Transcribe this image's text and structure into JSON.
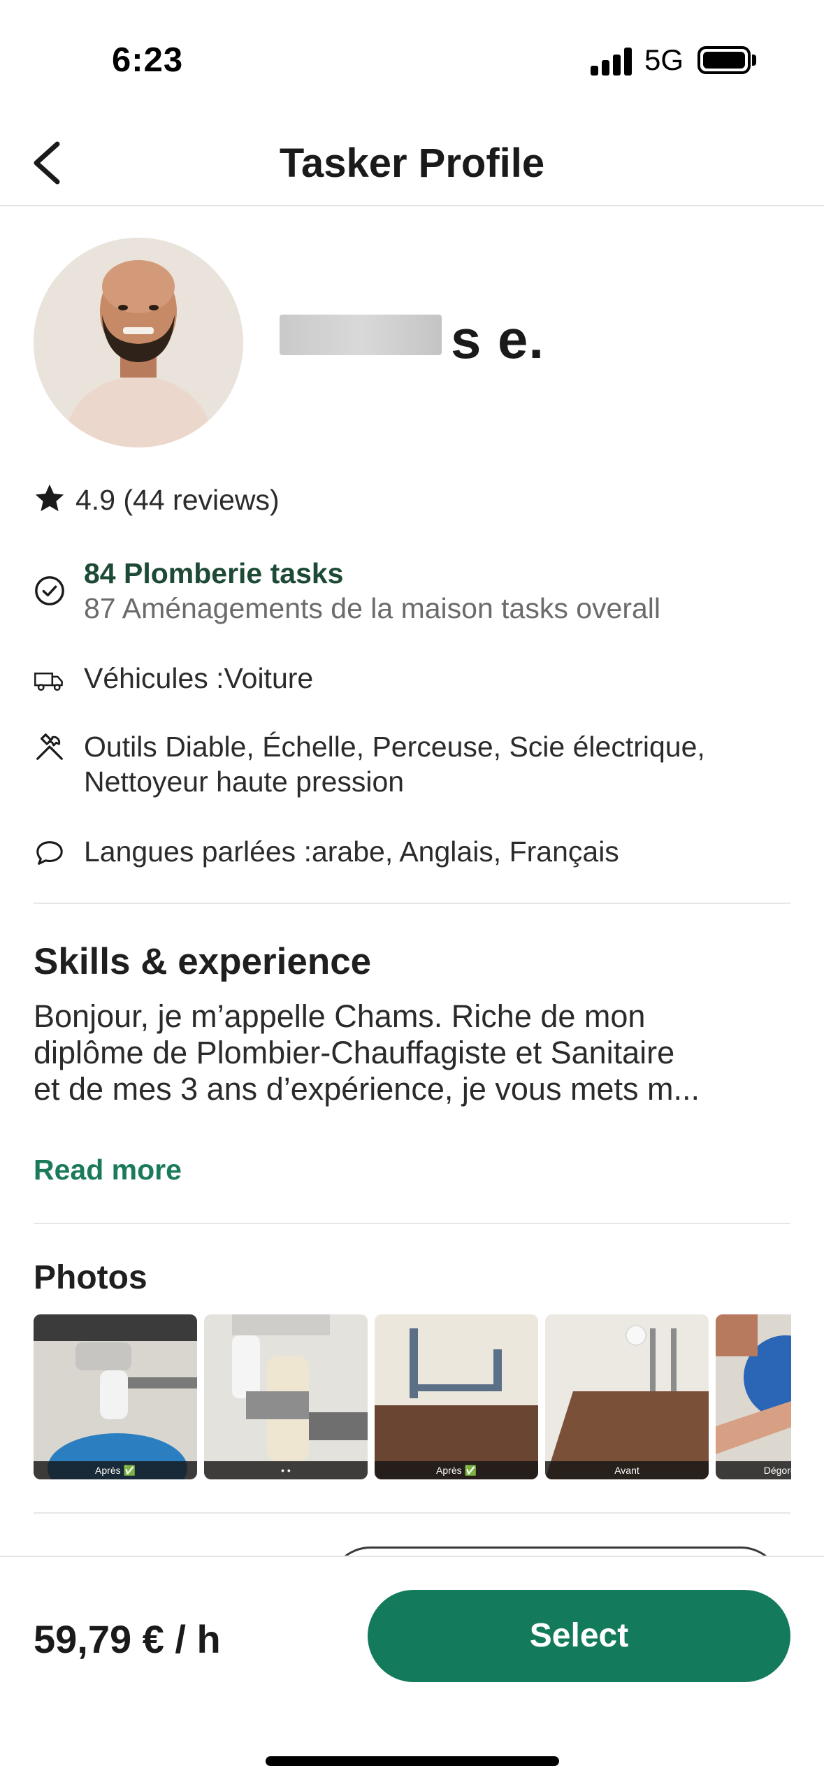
{
  "status_bar": {
    "time": "6:23",
    "network": "5G"
  },
  "header": {
    "title": "Tasker Profile"
  },
  "tasker": {
    "name_suffix": "s e."
  },
  "rating": {
    "text": "4.9 (44 reviews)"
  },
  "tasks": {
    "main": "84 Plomberie tasks",
    "overall": "87 Aménagements de la maison tasks overall"
  },
  "vehicles": {
    "text": "Véhicules :Voiture"
  },
  "tools": {
    "line1": "Outils Diable, Échelle, Perceuse, Scie électrique,",
    "line2": "Nettoyeur haute pression"
  },
  "languages": {
    "text": "Langues parlées :arabe, Anglais, Français"
  },
  "skills": {
    "title": "Skills & experience",
    "bio_line1": "Bonjour, je m’appelle Chams. Riche de mon",
    "bio_line2": "diplôme de Plombier-Chauffagiste et Sanitaire",
    "bio_line3": "et de mes 3 ans d’expérience, je vous mets m...",
    "read_more": "Read more"
  },
  "photos": {
    "title": "Photos",
    "captions": [
      "Après ✅",
      "• •",
      "Après ✅",
      "Avant",
      "Dégorgement é"
    ]
  },
  "footer": {
    "price": "59,79 € / h",
    "select_label": "Select"
  }
}
